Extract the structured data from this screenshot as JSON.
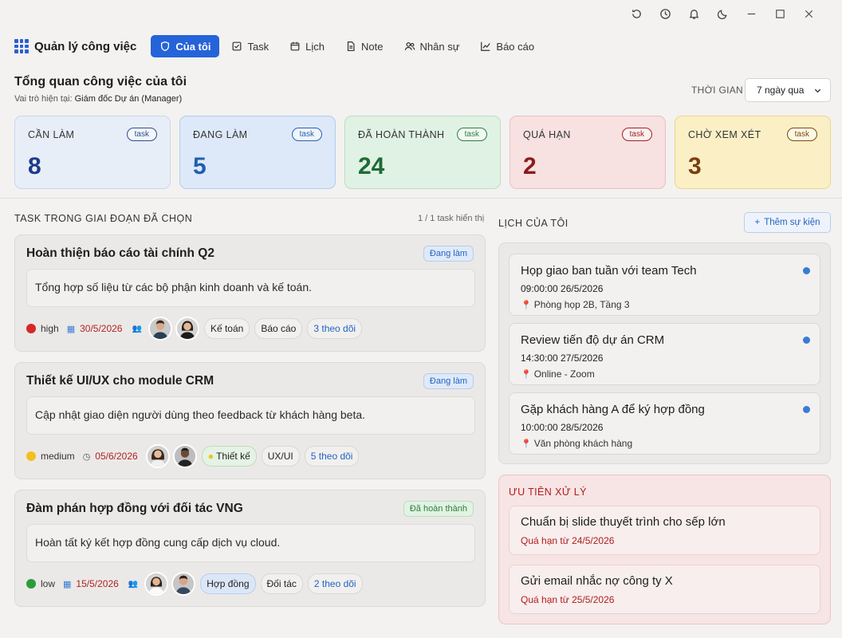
{
  "titlebar": {
    "icons": [
      "refresh-icon",
      "history-icon",
      "bell-icon",
      "moon-icon",
      "minimize-icon",
      "maximize-icon",
      "close-icon"
    ]
  },
  "nav": {
    "brand": "Quản lý công việc",
    "items": [
      {
        "label": "Của tôi",
        "icon": "shield-icon",
        "active": true
      },
      {
        "label": "Task",
        "icon": "checkbox-icon",
        "active": false
      },
      {
        "label": "Lịch",
        "icon": "calendar-icon",
        "active": false
      },
      {
        "label": "Note",
        "icon": "note-icon",
        "active": false
      },
      {
        "label": "Nhân sự",
        "icon": "users-icon",
        "active": false
      },
      {
        "label": "Báo cáo",
        "icon": "chart-icon",
        "active": false
      }
    ]
  },
  "overview": {
    "title": "Tổng quan công việc của tôi",
    "role_prefix": "Vai trò hiện tại: ",
    "role": "Giám đốc Dự án (Manager)",
    "time_label": "THỜI GIAN",
    "time_value": "7 ngày qua"
  },
  "stats": [
    {
      "label": "CẦN LÀM",
      "badge": "task",
      "value": "8",
      "color": "#1e3a8a",
      "bg": "#e8eef7",
      "border": "#c9d6ea",
      "badge_color": "#2a4f8f"
    },
    {
      "label": "ĐANG LÀM",
      "badge": "task",
      "value": "5",
      "color": "#1f5fb0",
      "bg": "#dde9f8",
      "border": "#b4cdee",
      "badge_color": "#2a5fb0"
    },
    {
      "label": "ĐÃ HOÀN THÀNH",
      "badge": "task",
      "value": "24",
      "color": "#1f6b37",
      "bg": "#e0f2e3",
      "border": "#b9dfc0",
      "badge_color": "#2e7d3e"
    },
    {
      "label": "QUÁ HẠN",
      "badge": "task",
      "value": "2",
      "color": "#8c1c1c",
      "bg": "#f7e1e1",
      "border": "#ecc0c0",
      "badge_color": "#a32020"
    },
    {
      "label": "CHỜ XEM XÉT",
      "badge": "task",
      "value": "3",
      "color": "#7a3e10",
      "bg": "#fbefc6",
      "border": "#ecd68a",
      "badge_color": "#7a4a10"
    }
  ],
  "tasks_section": {
    "label": "TASK TRONG GIAI ĐOẠN ĐÃ CHỌN",
    "count": "1 / 1 task hiển thị"
  },
  "tasks": [
    {
      "title": "Hoàn thiện báo cáo tài chính Q2",
      "status": "Đang làm",
      "status_type": "progress",
      "desc": "Tổng hợp số liệu từ các bộ phận kinh doanh và kế toán.",
      "priority": "high",
      "priority_color": "#d62828",
      "due": "30/5/2026",
      "tags": [
        {
          "text": "Kế toán",
          "style": ""
        },
        {
          "text": "Báo cáo",
          "style": ""
        }
      ],
      "follow": "3 theo dõi"
    },
    {
      "title": "Thiết kế UI/UX cho module CRM",
      "status": "Đang làm",
      "status_type": "progress",
      "desc": "Cập nhật giao diện người dùng theo feedback từ khách hàng beta.",
      "priority": "medium",
      "priority_color": "#f2c01e",
      "due": "05/6/2026",
      "tags": [
        {
          "text": "Thiết kế",
          "style": "green",
          "dot": true
        },
        {
          "text": "UX/UI",
          "style": ""
        }
      ],
      "follow": "5 theo dõi"
    },
    {
      "title": "Đàm phán hợp đồng với đối tác VNG",
      "status": "Đã hoàn thành",
      "status_type": "done",
      "desc": "Hoàn tất ký kết hợp đồng cung cấp dịch vụ cloud.",
      "priority": "low",
      "priority_color": "#2a9d3a",
      "due": "15/5/2026",
      "tags": [
        {
          "text": "Hợp đồng",
          "style": "blue"
        },
        {
          "text": "Đối tác",
          "style": ""
        }
      ],
      "follow": "2 theo dõi"
    }
  ],
  "calendar": {
    "label": "LỊCH CỦA TÔI",
    "add_label": "Thêm sự kiện",
    "events": [
      {
        "title": "Họp giao ban tuần với team Tech",
        "time": "09:00:00 26/5/2026",
        "location": "Phòng họp 2B, Tầng 3"
      },
      {
        "title": "Review tiến độ dự án CRM",
        "time": "14:30:00 27/5/2026",
        "location": "Online - Zoom"
      },
      {
        "title": "Gặp khách hàng A để ký hợp đồng",
        "time": "10:00:00 28/5/2026",
        "location": "Văn phòng khách hàng"
      }
    ]
  },
  "priority": {
    "label": "ƯU TIÊN XỬ LÝ",
    "items": [
      {
        "title": "Chuẩn bị slide thuyết trình cho sếp lớn",
        "due": "Quá hạn từ 24/5/2026"
      },
      {
        "title": "Gửi email nhắc nợ công ty X",
        "due": "Quá hạn từ 25/5/2026"
      }
    ]
  }
}
